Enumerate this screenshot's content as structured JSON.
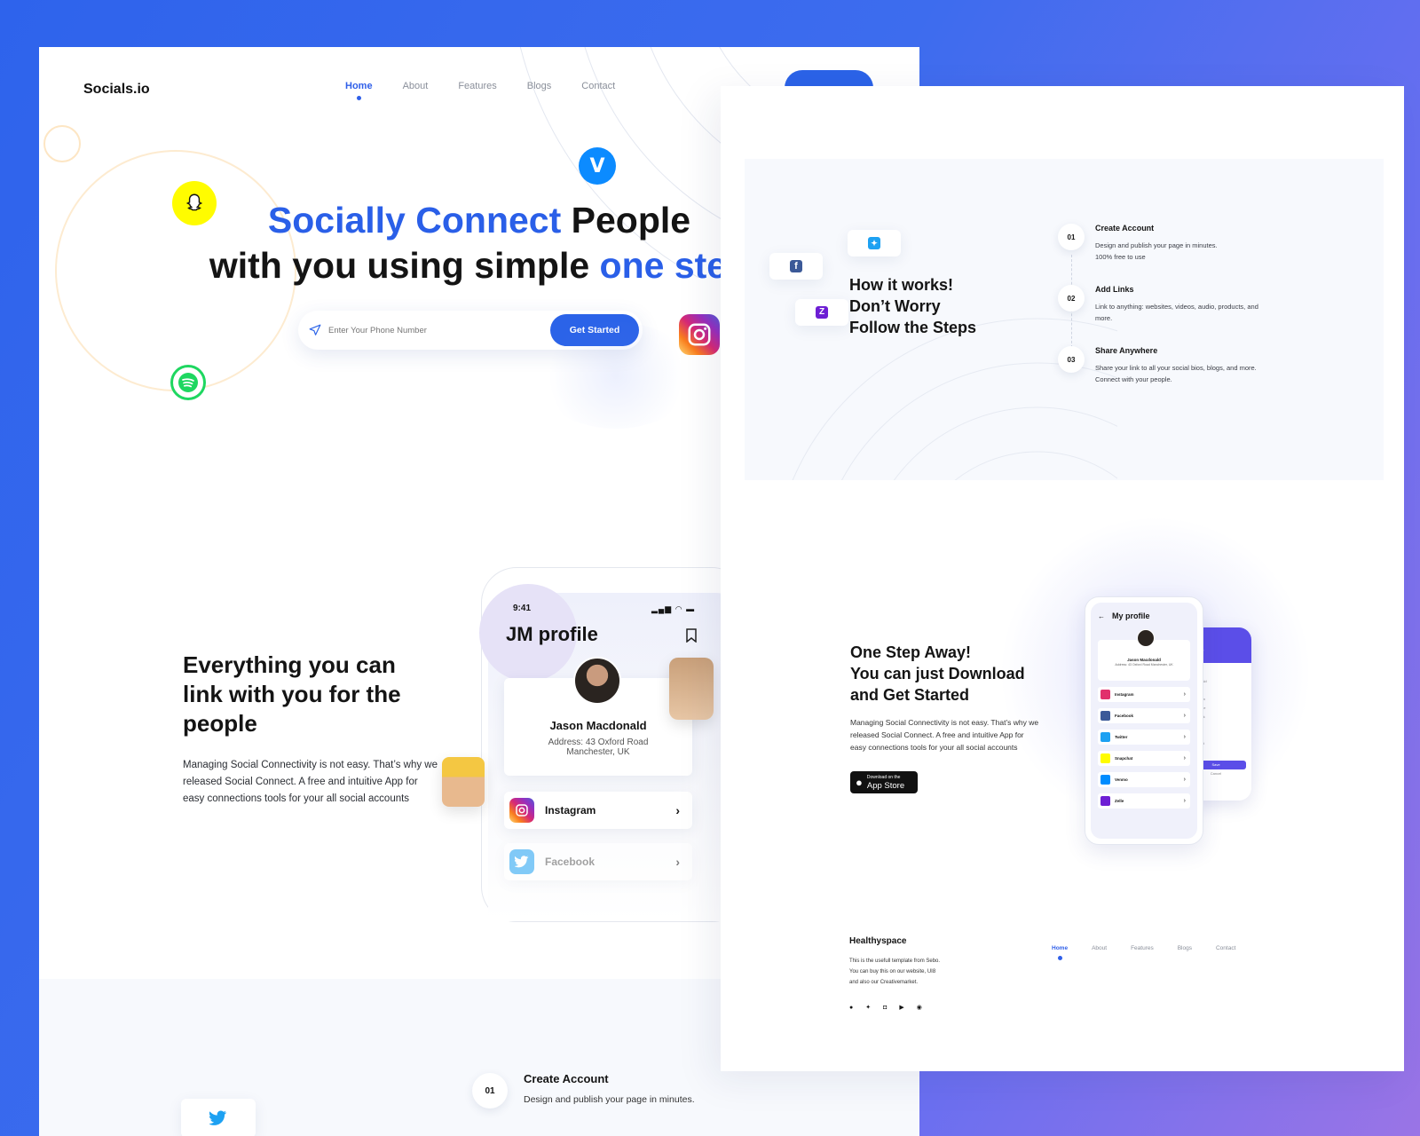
{
  "back": {
    "logo": "Socials.io",
    "nav": [
      {
        "label": "Home",
        "active": true
      },
      {
        "label": "About"
      },
      {
        "label": "Features"
      },
      {
        "label": "Blogs"
      },
      {
        "label": "Contact"
      }
    ],
    "hero": {
      "line1_a": "Socially Connect",
      "line1_b": " People",
      "line2_a": "with you using simple ",
      "line2_b": "one step"
    },
    "search": {
      "placeholder": "Enter Your Phone Number",
      "button": "Get Started"
    },
    "feature": {
      "title": "Everything you can link with you for the people",
      "text": "Managing Social Connectivity is not easy. That’s why we released Social Connect. A free and intuitive App for easy connections tools for your all social accounts"
    },
    "phone": {
      "time": "9:41",
      "title": "JM profile",
      "name": "Jason Macdonald",
      "address1": "Address: 43 Oxford Road",
      "address2": "Manchester, UK",
      "items": [
        "Instagram",
        "Facebook"
      ]
    },
    "step": {
      "num": "01",
      "title": "Create Account",
      "text": "Design and publish your page in minutes."
    }
  },
  "front": {
    "how": {
      "title_l1": "How it works!",
      "title_l2": "Don’t Worry",
      "title_l3": "Follow the Steps"
    },
    "steps": [
      {
        "num": "01",
        "title": "Create Account",
        "l1": "Design and publish your page in minutes.",
        "l2": "100% free to use"
      },
      {
        "num": "02",
        "title": "Add Links",
        "l1": "Link to anything: websites, videos, audio, products, and",
        "l2": "more."
      },
      {
        "num": "03",
        "title": "Share Anywhere",
        "l1": "Share your link to all your social bios, blogs, and more.",
        "l2": "Connect with your people."
      }
    ],
    "download": {
      "l1": "One Step Away!",
      "l2": "You can just Download",
      "l3": "and Get Started",
      "text": "Managing Social Connectivity is not easy. That’s why we released Social Connect. A free and intuitive App for easy connections tools for your all social accounts",
      "store_small": "Download on the",
      "store_big": "App Store"
    },
    "phone": {
      "title": "My profile",
      "name": "Jason Macdonald",
      "address": "Address: 43 Oxford Road Manchester, UK",
      "items": [
        "Instagram",
        "Facebook",
        "Twitter",
        "Snapchat",
        "Venmo",
        "Zelle"
      ],
      "second_title1": "dit",
      "second_title2": "ofile",
      "second_save": "Save",
      "second_cancel": "Cancel",
      "second_fields": [
        "Name",
        "Macdonald",
        "Location",
        "Instagram",
        "Username",
        "Facebook",
        "Twitter",
        "Zelle",
        "Snapchat",
        "Spotify"
      ]
    },
    "footer": {
      "brand": "Healthyspace",
      "l1": "This is the usefull template from Sebo.",
      "l2": "You can buy this on our website, UI8",
      "l3": "and also our Creativemarket.",
      "nav": [
        {
          "label": "Home",
          "active": true
        },
        {
          "label": "About"
        },
        {
          "label": "Features"
        },
        {
          "label": "Blogs"
        },
        {
          "label": "Contact"
        }
      ]
    }
  },
  "colors": {
    "accent": "#2b63e8",
    "instagram": "#e1306c",
    "twitter": "#1da1f2",
    "facebook": "#3b5998",
    "snapchat": "#fffc00",
    "spotify": "#1ed760",
    "venmo": "#008cff",
    "zelle": "#6d1ed4"
  }
}
